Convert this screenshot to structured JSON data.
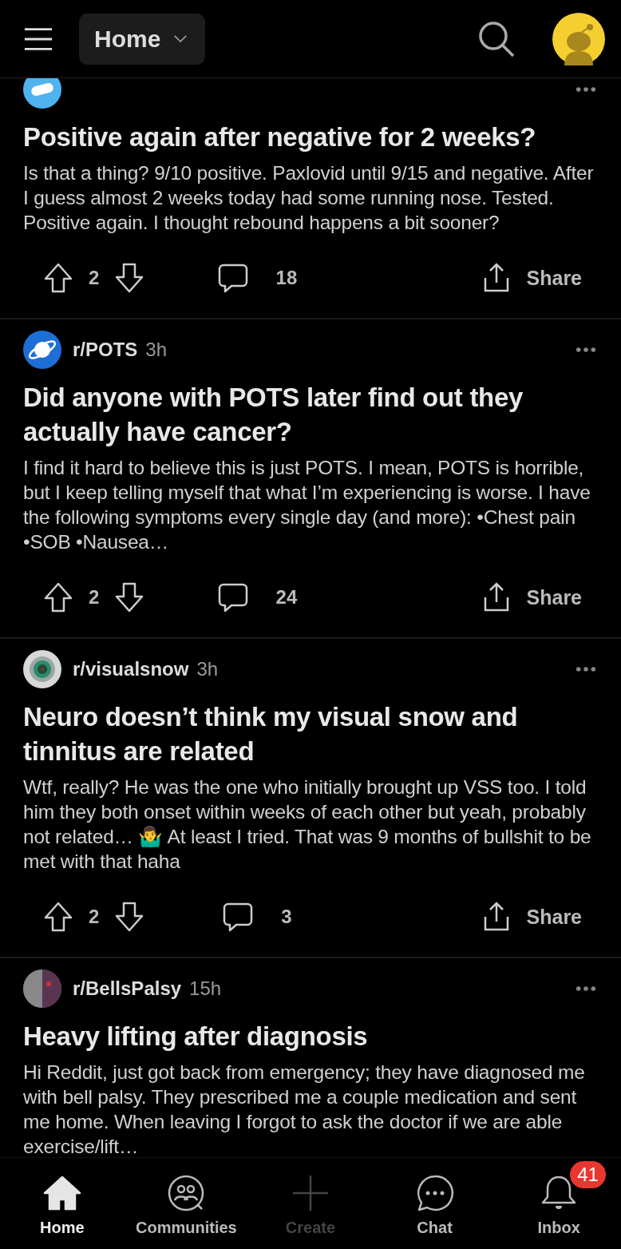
{
  "header": {
    "feed_label": "Home"
  },
  "posts": [
    {
      "avatar": {
        "kind": "badge"
      },
      "title": "Positive again after negative for 2 weeks?",
      "body": "Is that a thing? 9/10 positive. Paxlovid until 9/15 and negative. After I guess almost 2 weeks today had some running nose. Tested. Positive again. I thought rebound happens a bit sooner?",
      "votes": "2",
      "comments": "18",
      "share": "Share"
    },
    {
      "subreddit": "r/POTS",
      "age": "3h",
      "avatar": {
        "kind": "planet"
      },
      "title": "Did anyone with POTS later find out they actually have cancer?",
      "body": "I find it hard to believe this is just POTS. I mean, POTS is horrible, but I keep telling myself that what I’m experiencing is worse. I have the following symptoms every single day (and more): •Chest pain •SOB •Nausea…",
      "votes": "2",
      "comments": "24",
      "share": "Share"
    },
    {
      "subreddit": "r/visualsnow",
      "age": "3h",
      "avatar": {
        "kind": "eye"
      },
      "title": "Neuro doesn’t think my visual snow and tinnitus are related",
      "body": "Wtf, really? He was the one who initially brought up VSS too. I told him they both onset within weeks of each other but yeah, probably not related… 🤷‍♂️ At least I tried. That was 9 months of bullshit to be met with that haha",
      "votes": "2",
      "comments": "3",
      "share": "Share"
    },
    {
      "subreddit": "r/BellsPalsy",
      "age": "15h",
      "avatar": {
        "kind": "portrait"
      },
      "title": "Heavy lifting after diagnosis",
      "body": "Hi Reddit, just got back from emergency; they have diagnosed me with  bell palsy. They prescribed me a couple medication and sent me home. When leaving I forgot to ask the doctor if we are able exercise/lift…"
    }
  ],
  "nav": [
    {
      "label": "Home",
      "kind": "home",
      "selected": true,
      "disabled": false
    },
    {
      "label": "Communities",
      "kind": "communities",
      "selected": false,
      "disabled": false
    },
    {
      "label": "Create",
      "kind": "create",
      "selected": false,
      "disabled": true
    },
    {
      "label": "Chat",
      "kind": "chat",
      "selected": false,
      "disabled": false
    },
    {
      "label": "Inbox",
      "kind": "inbox",
      "selected": false,
      "disabled": false,
      "badge": "41"
    }
  ]
}
